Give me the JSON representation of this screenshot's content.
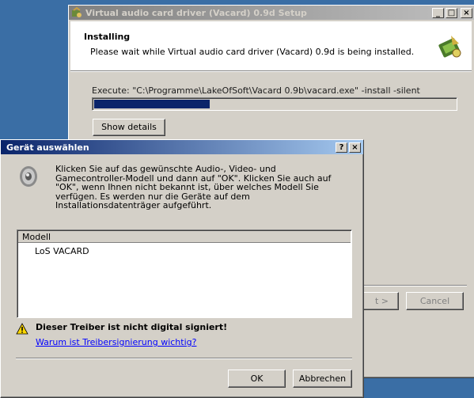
{
  "setup": {
    "title": "Virtual audio card driver (Vacard) 0.9d Setup",
    "header_title": "Installing",
    "header_subtitle": "Please wait while Virtual audio card driver (Vacard) 0.9d is being installed.",
    "execute_text": "Execute: \"C:\\Programme\\LakeOfSoft\\Vacard 0.9b\\vacard.exe\" -install -silent",
    "progress": 0.32,
    "show_details_label": "Show details",
    "next_label": "Next >",
    "cancel_label": "Cancel",
    "next_visible": "t >"
  },
  "dialog": {
    "title": "Gerät auswählen",
    "help_btn": "?",
    "close_btn": "×",
    "instructions": "Klicken Sie auf das gewünschte Audio-, Video- und Gamecontroller-Modell und dann auf \"OK\". Klicken Sie auch auf \"OK\", wenn Ihnen nicht bekannt ist, über welches Modell Sie verfügen. Es werden nur die Geräte auf dem Installationsdatenträger aufgeführt.",
    "list_header": "Modell",
    "models": [
      "LoS VACARD"
    ],
    "warning": "Dieser Treiber ist nicht digital signiert!",
    "warning_link": "Warum ist Treibersignierung wichtig?",
    "ok_label": "OK",
    "cancel_label": "Abbrechen"
  },
  "icons": {
    "setup_app": "installer-icon",
    "header_logo": "setup-wizard-icon",
    "speaker": "speaker-icon",
    "warning": "warning-icon"
  },
  "colors": {
    "progress_fill": "#0a246a",
    "link": "#0000ff",
    "inactive_title": "#808080",
    "active_title": "#0a246a"
  }
}
